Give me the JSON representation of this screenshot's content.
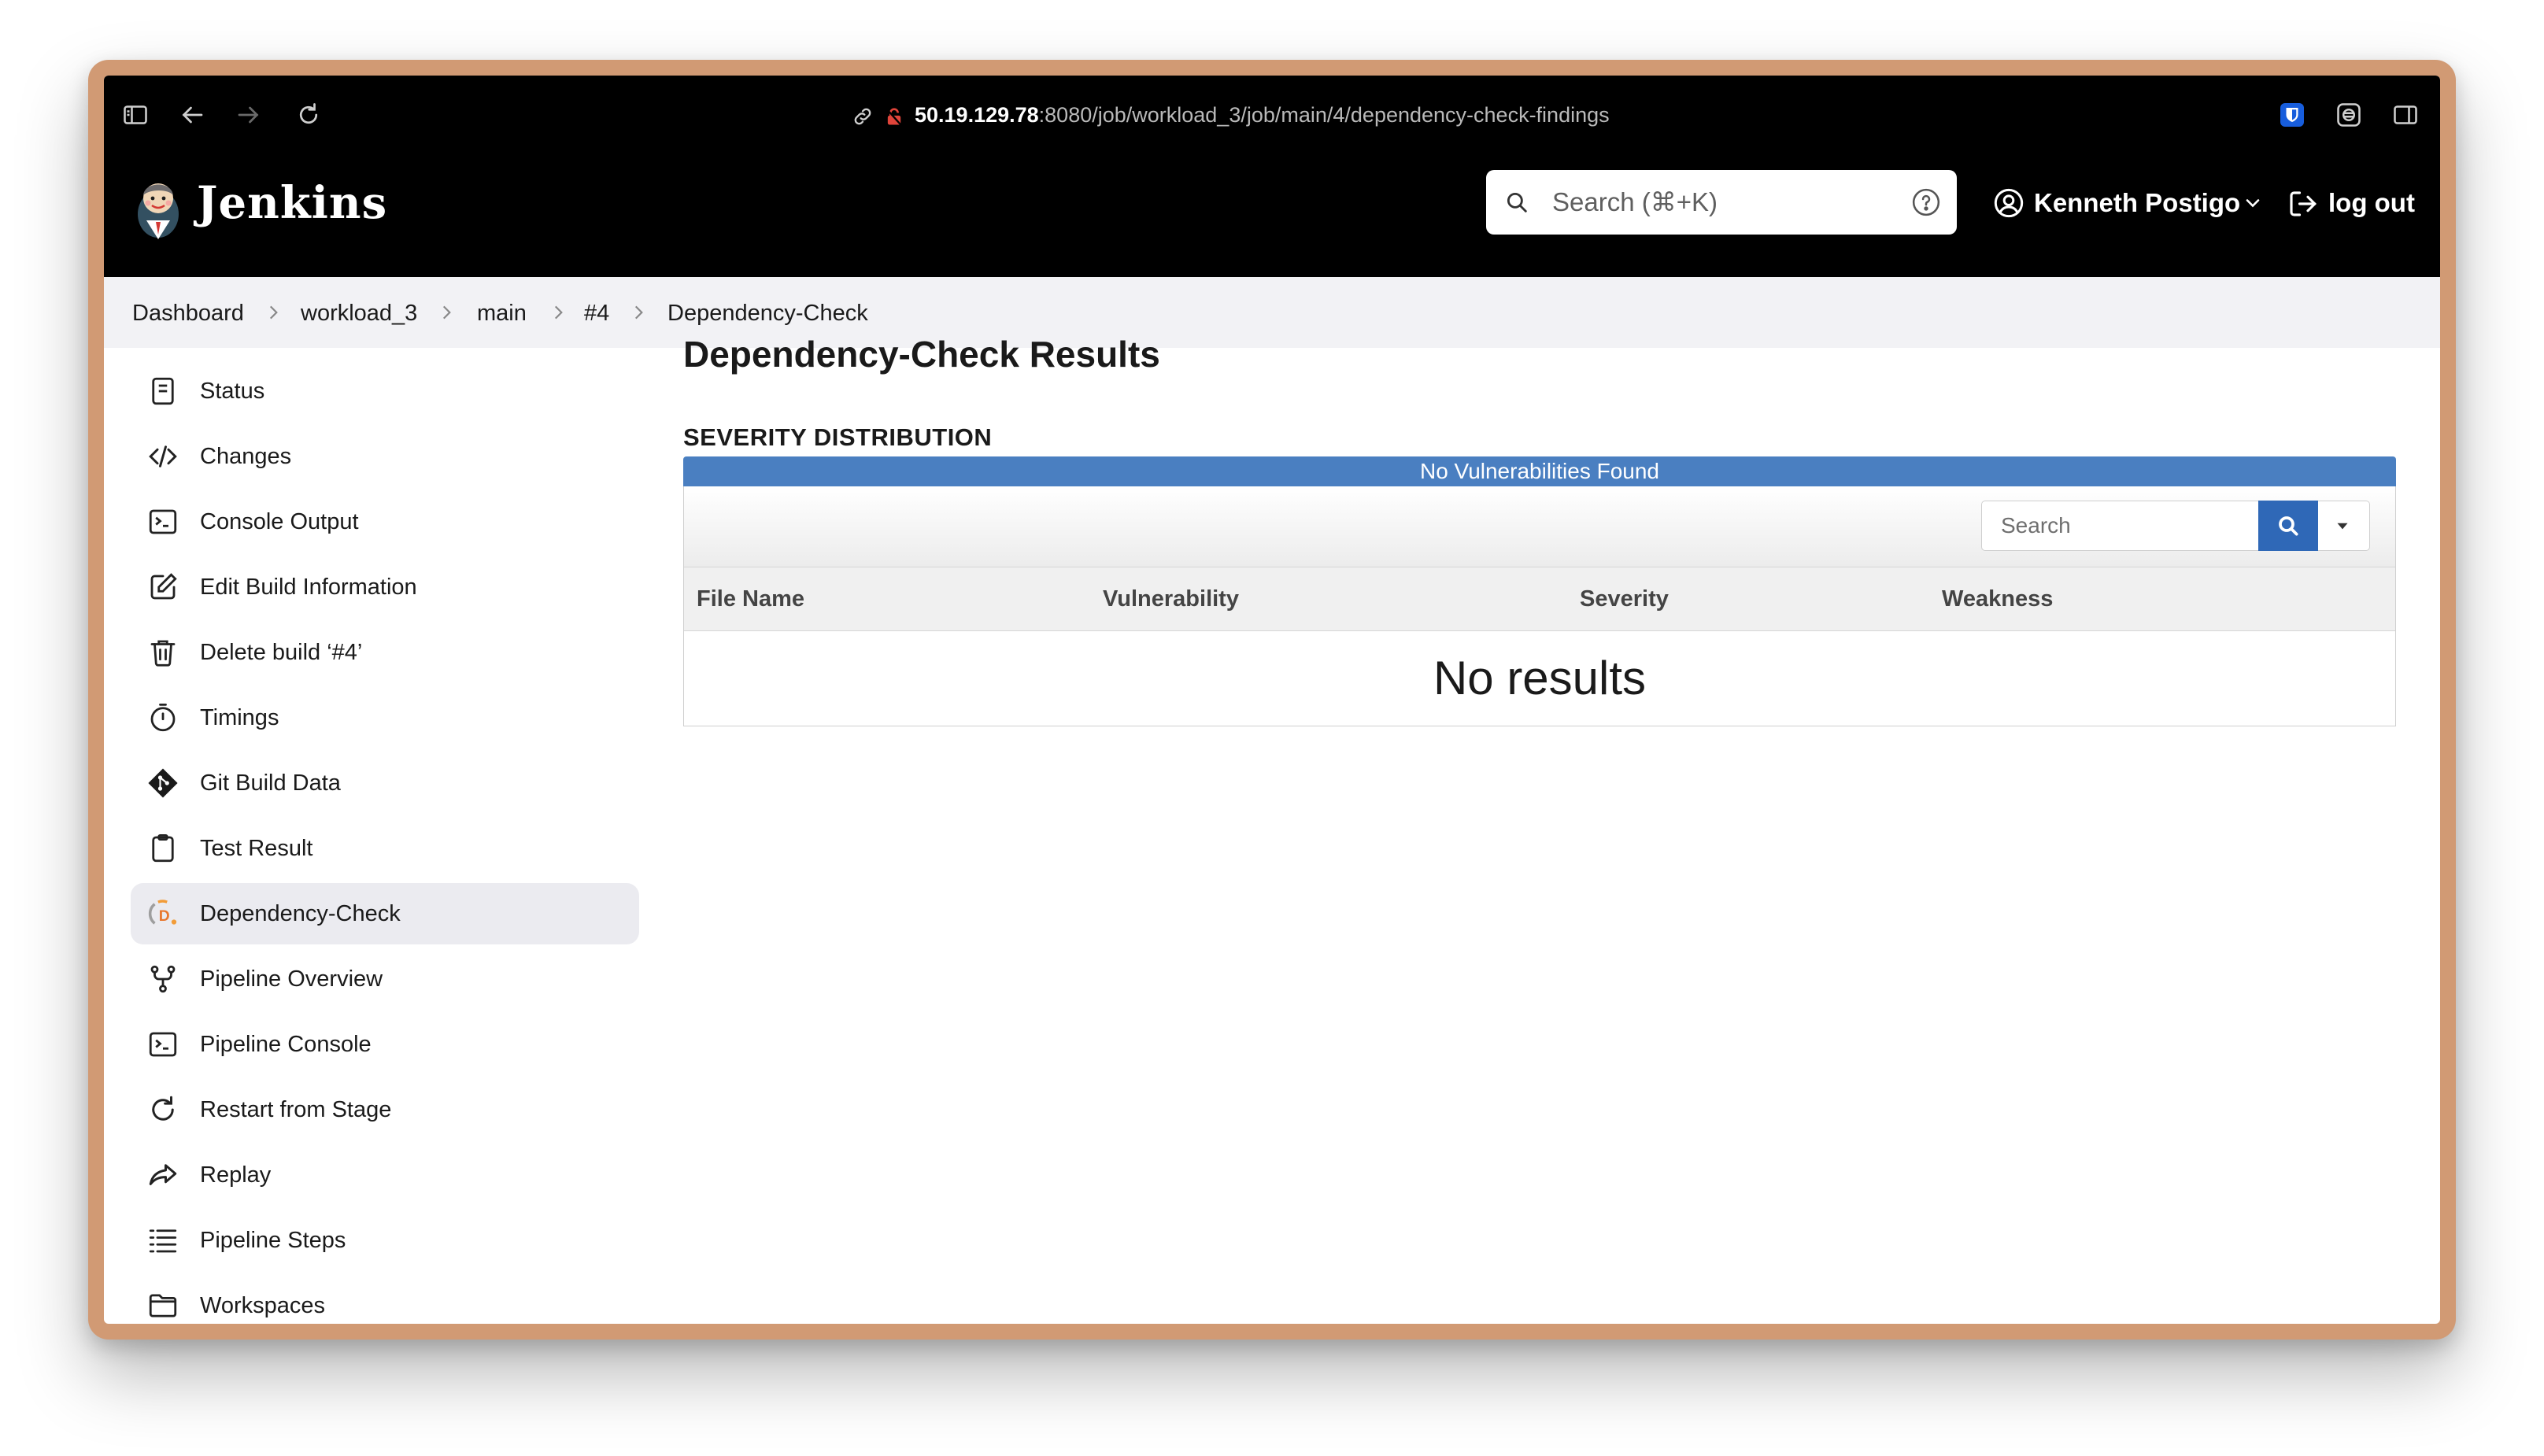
{
  "browser": {
    "url_host": "50.19.129.78",
    "url_path": ":8080/job/workload_3/job/main/4/dependency-check-findings"
  },
  "header": {
    "logo_text": "Jenkins",
    "search_placeholder": "Search (⌘+K)",
    "user_name": "Kenneth Postigo",
    "logout_label": "log out"
  },
  "breadcrumb": [
    "Dashboard",
    "workload_3",
    "main",
    "#4",
    "Dependency-Check"
  ],
  "sidebar": {
    "items": [
      {
        "label": "Status",
        "icon": "status-icon"
      },
      {
        "label": "Changes",
        "icon": "code-icon"
      },
      {
        "label": "Console Output",
        "icon": "terminal-icon"
      },
      {
        "label": "Edit Build Information",
        "icon": "edit-icon"
      },
      {
        "label": "Delete build ‘#4’",
        "icon": "trash-icon"
      },
      {
        "label": "Timings",
        "icon": "stopwatch-icon"
      },
      {
        "label": "Git Build Data",
        "icon": "git-icon"
      },
      {
        "label": "Test Result",
        "icon": "clipboard-icon"
      },
      {
        "label": "Dependency-Check",
        "icon": "dependency-check-icon",
        "active": true
      },
      {
        "label": "Pipeline Overview",
        "icon": "pipeline-icon"
      },
      {
        "label": "Pipeline Console",
        "icon": "terminal-icon"
      },
      {
        "label": "Restart from Stage",
        "icon": "restart-icon"
      },
      {
        "label": "Replay",
        "icon": "replay-icon"
      },
      {
        "label": "Pipeline Steps",
        "icon": "steps-icon"
      },
      {
        "label": "Workspaces",
        "icon": "folder-icon"
      }
    ]
  },
  "main": {
    "title": "Dependency-Check Results",
    "severity_heading": "SEVERITY DISTRIBUTION",
    "severity_bar_text": "No Vulnerabilities Found",
    "search_placeholder": "Search",
    "columns": [
      "File Name",
      "Vulnerability",
      "Severity",
      "Weakness"
    ],
    "empty_text": "No results"
  },
  "colors": {
    "header_bg": "#000000",
    "breadcrumb_bg": "#f2f2f5",
    "active_item_bg": "#ebebf0",
    "severity_bar": "#4a7fc1",
    "search_button": "#2f68b7",
    "window_frame": "#d19a74"
  }
}
